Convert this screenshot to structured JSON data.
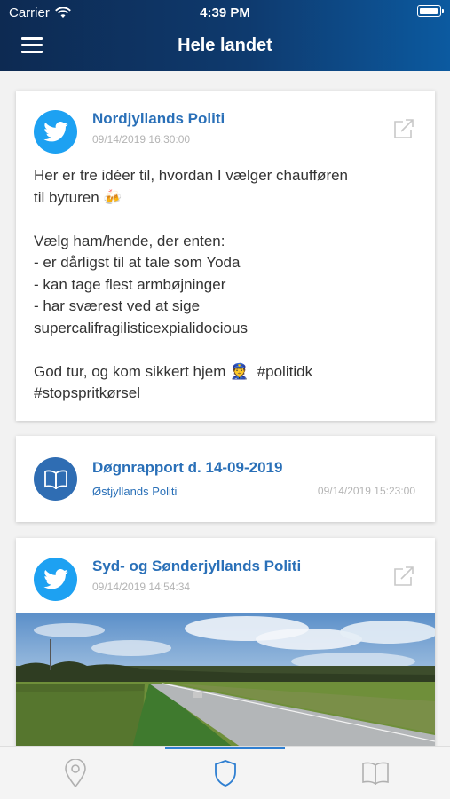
{
  "status_bar": {
    "carrier": "Carrier",
    "time": "4:39 PM"
  },
  "header": {
    "title": "Hele landet",
    "menu_icon": "hamburger-menu-icon"
  },
  "posts": [
    {
      "type": "twitter",
      "author": "Nordjyllands Politi",
      "timestamp": "09/14/2019 16:30:00",
      "text": "Her er tre idéer til, hvordan I vælger chaufføren\ntil byturen 🍻\n\nVælg ham/hende, der enten:\n- er dårligst til at tale som Yoda\n- kan tage flest armbøjninger\n- har sværest ved at sige\nsupercalifragilisticexpialidocious\n\nGod tur, og kom sikkert hjem 👮  #politidk\n#stopspritkørsel"
    },
    {
      "type": "report",
      "title": "Døgnrapport d. 14-09-2019",
      "source": "Østjyllands Politi",
      "timestamp": "09/14/2019 15:23:00"
    },
    {
      "type": "twitter",
      "author": "Syd- og Sønderjyllands Politi",
      "timestamp": "09/14/2019 14:54:34",
      "image": "countryside-road-photo"
    }
  ],
  "tab_bar": {
    "tabs": [
      {
        "icon": "location-pin-icon",
        "active": false
      },
      {
        "icon": "police-shield-icon",
        "active": true
      },
      {
        "icon": "book-icon",
        "active": false
      }
    ]
  },
  "colors": {
    "header_dark": "#0d2a52",
    "header_light": "#0c5aa0",
    "link_blue": "#2a70b8",
    "twitter_blue": "#1da1f2",
    "tab_active": "#2f7fd1"
  }
}
